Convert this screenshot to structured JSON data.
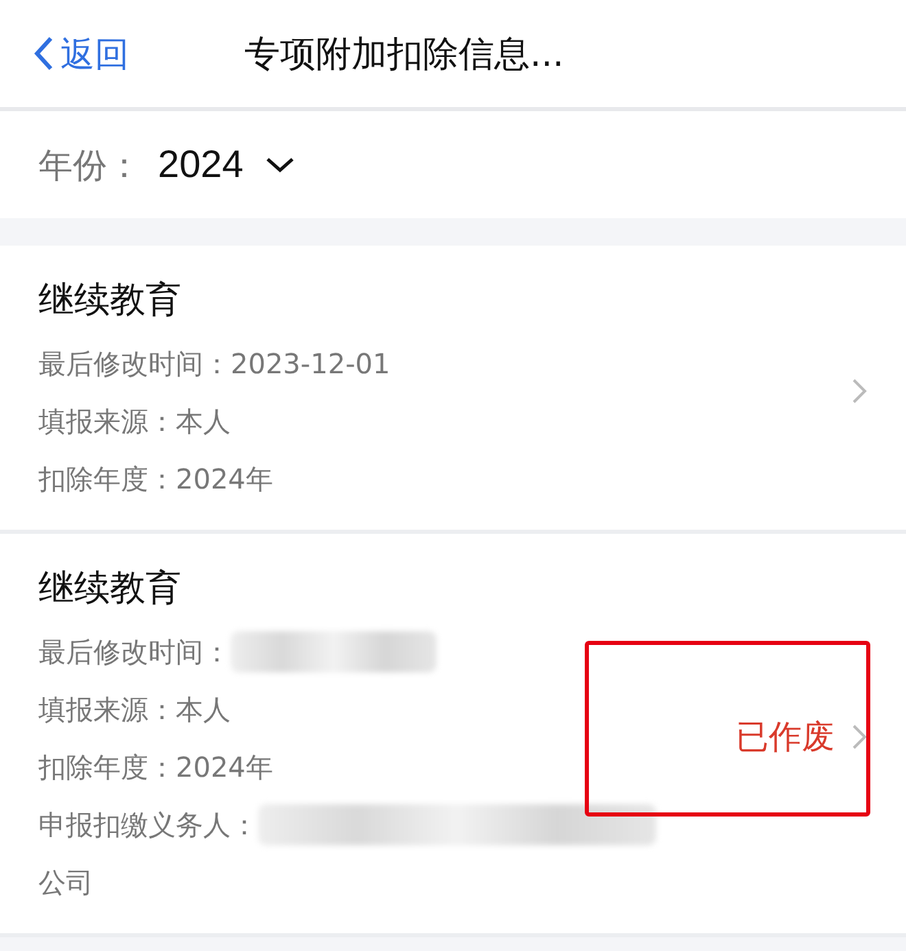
{
  "header": {
    "back": "返回",
    "title": "专项附加扣除信息..."
  },
  "year_filter": {
    "label": "年份：",
    "value": "2024"
  },
  "records": [
    {
      "title": "继续教育",
      "fields": [
        {
          "label": "最后修改时间：",
          "value": "2023-12-01",
          "redacted": false
        },
        {
          "label": "填报来源：",
          "value": "本人",
          "redacted": false
        },
        {
          "label": "扣除年度：",
          "value": "2024年",
          "redacted": false
        }
      ],
      "highlighted": false
    },
    {
      "title": "继续教育",
      "fields": [
        {
          "label": "最后修改时间：",
          "redacted": true
        },
        {
          "label": "填报来源：",
          "value": "本人",
          "redacted": false
        },
        {
          "label": "扣除年度：",
          "value": "2024年",
          "redacted": false
        },
        {
          "label": "申报扣缴义务人：",
          "redacted": true,
          "continuation": "公司"
        }
      ],
      "status": "已作废",
      "highlighted": true
    }
  ]
}
